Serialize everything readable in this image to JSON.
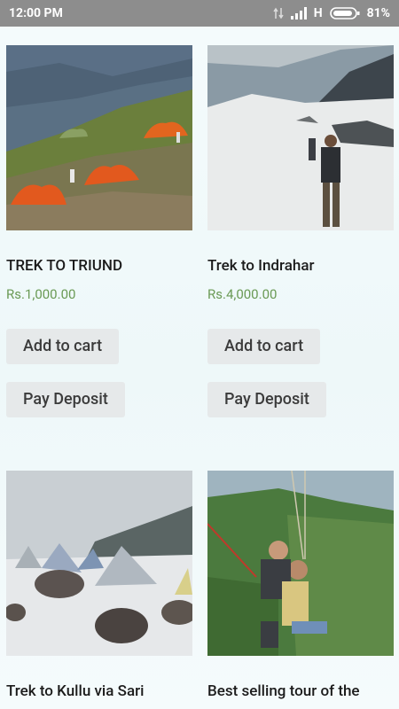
{
  "status_bar": {
    "time": "12:00 PM",
    "network": "H",
    "battery": "81%"
  },
  "products": [
    {
      "title": "TREK TO TRIUND",
      "price": "Rs.1,000.00",
      "add_to_cart": "Add to cart",
      "pay_deposit": "Pay Deposit"
    },
    {
      "title": "Trek to Indrahar",
      "price": "Rs.4,000.00",
      "add_to_cart": "Add to cart",
      "pay_deposit": "Pay Deposit"
    },
    {
      "title": "Trek to Kullu via Sari"
    },
    {
      "title": "Best selling tour of the"
    }
  ]
}
